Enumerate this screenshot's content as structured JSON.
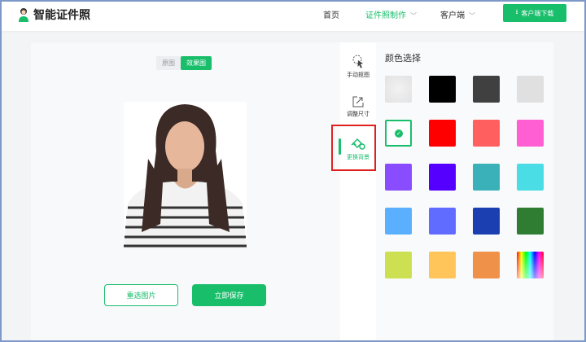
{
  "header": {
    "app_title": "智能证件照",
    "nav": [
      "首页",
      "证件照制作",
      "客户端"
    ],
    "download_label": "客户端下载"
  },
  "editor": {
    "toggle": {
      "original": "原图",
      "effect": "效果图"
    },
    "reselect_label": "重选图片",
    "save_label": "立即保存"
  },
  "tools": [
    {
      "label": "手动抠图",
      "icon": "cursor-icon"
    },
    {
      "label": "调整尺寸",
      "icon": "resize-icon"
    },
    {
      "label": "更换背景",
      "icon": "paint-bucket-icon",
      "active": true
    }
  ],
  "color_panel": {
    "title": "颜色选择",
    "selected_index": 4,
    "swatches": [
      "transparent",
      "#000000",
      "#404040",
      "#e0e0e0",
      "#ffffff",
      "#ff0000",
      "#ff5f5f",
      "#ff5fd2",
      "#8a4cff",
      "#5500ff",
      "#3ab0b8",
      "#4adde6",
      "#5ab0ff",
      "#5f6cff",
      "#1b3fb0",
      "#2e7d32",
      "#cde052",
      "#ffc55a",
      "#f0914a",
      "rainbow"
    ]
  },
  "accent": "#19be6b"
}
